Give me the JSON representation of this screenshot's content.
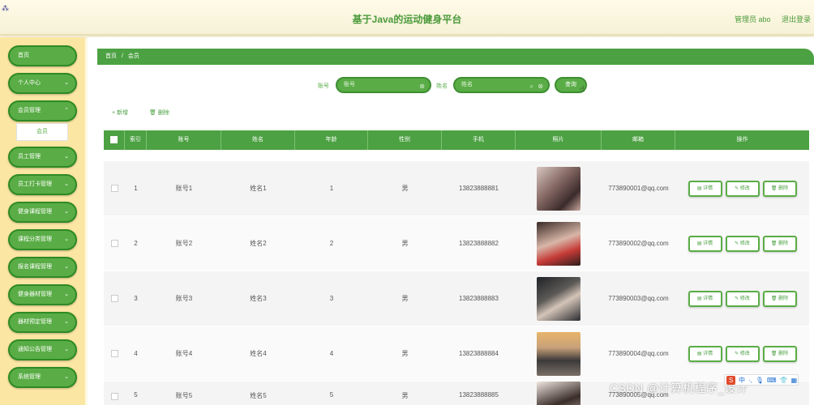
{
  "header": {
    "title": "基于Java的运动健身平台",
    "admin_label": "管理员 abo",
    "logout_label": "退出登录"
  },
  "sidebar": {
    "items": [
      {
        "label": "首页"
      },
      {
        "label": "个人中心"
      },
      {
        "label": "会员管理"
      },
      {
        "label": "员工管理"
      },
      {
        "label": "员工打卡管理"
      },
      {
        "label": "健身课程管理"
      },
      {
        "label": "课程分类管理"
      },
      {
        "label": "报名课程管理"
      },
      {
        "label": "健身器材管理"
      },
      {
        "label": "器材预定管理"
      },
      {
        "label": "通知公告管理"
      },
      {
        "label": "系统管理"
      }
    ],
    "submenu_label": "会员"
  },
  "breadcrumb": {
    "home": "首页",
    "separator": "/",
    "current": "会员"
  },
  "search": {
    "account_label": "账号",
    "account_placeholder": "账号",
    "name_label": "姓名",
    "name_value": "姓名",
    "query_label": "查询"
  },
  "actions": {
    "add_label": "+ 新增",
    "delete_label": "删除"
  },
  "table": {
    "headers": [
      "索引",
      "账号",
      "姓名",
      "年龄",
      "性别",
      "手机",
      "照片",
      "邮箱",
      "操作"
    ],
    "op_labels": {
      "detail": "详情",
      "edit": "修改",
      "delete": "删除"
    },
    "rows": [
      {
        "index": "1",
        "account": "账号1",
        "name": "姓名1",
        "age": "1",
        "gender": "男",
        "phone": "13823888881",
        "email": "773890001@qq.com"
      },
      {
        "index": "2",
        "account": "账号2",
        "name": "姓名2",
        "age": "2",
        "gender": "男",
        "phone": "13823888882",
        "email": "773890002@qq.com"
      },
      {
        "index": "3",
        "account": "账号3",
        "name": "姓名3",
        "age": "3",
        "gender": "男",
        "phone": "13823888883",
        "email": "773890003@qq.com"
      },
      {
        "index": "4",
        "account": "账号4",
        "name": "姓名4",
        "age": "4",
        "gender": "男",
        "phone": "13823888884",
        "email": "773890004@qq.com"
      },
      {
        "index": "5",
        "account": "账号5",
        "name": "姓名5",
        "age": "5",
        "gender": "男",
        "phone": "13823888885",
        "email": "773890005@qq.com"
      }
    ]
  },
  "watermark": "CSDN @计算机程序_设计",
  "ime": {
    "mode": "中"
  }
}
